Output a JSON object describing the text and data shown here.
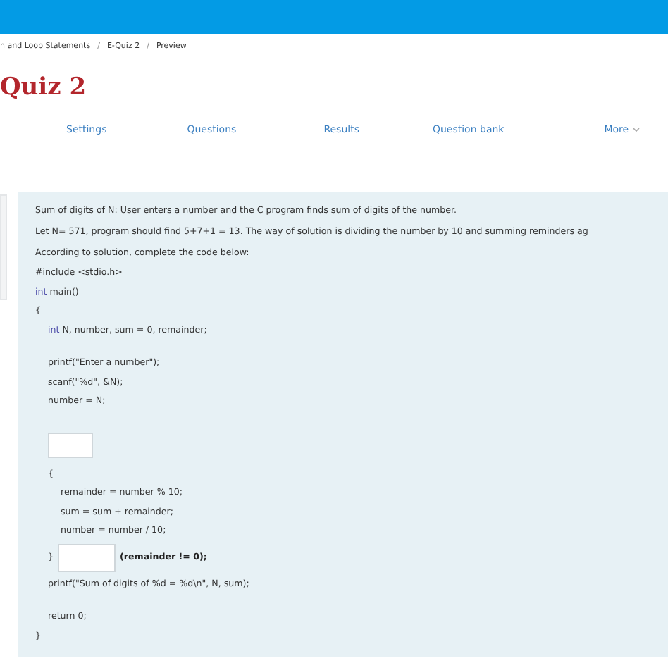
{
  "breadcrumb": {
    "separator": "/",
    "items": [
      "n and Loop Statements",
      "E-Quiz 2",
      "Preview"
    ]
  },
  "title": "Quiz 2",
  "tabs": [
    {
      "label": "Settings"
    },
    {
      "label": "Questions"
    },
    {
      "label": "Results"
    },
    {
      "label": "Question bank"
    },
    {
      "label": "More",
      "menu": true
    }
  ],
  "question": {
    "intro": [
      "Sum of digits of N: User enters a number and the C program finds sum of digits of the number.",
      "Let N= 571, program should find 5+7+1 = 13. The way of solution is dividing the number by 10 and summing reminders ag",
      "According to solution, complete the code below:"
    ],
    "code": [
      {
        "kind": "line",
        "text": "#include <stdio.h>"
      },
      {
        "kind": "line",
        "keyword": "int",
        "text": " main()"
      },
      {
        "kind": "line",
        "text": "{"
      },
      {
        "kind": "block",
        "children": [
          {
            "kind": "line",
            "keyword": "int",
            "text": " N, number, sum = 0, remainder;"
          },
          {
            "kind": "gap"
          },
          {
            "kind": "line",
            "text": "printf(\"Enter a number\");"
          },
          {
            "kind": "line",
            "text": "scanf(\"%d\", &N);"
          },
          {
            "kind": "line",
            "text": "number = N;"
          },
          {
            "kind": "gap"
          },
          {
            "kind": "blank"
          },
          {
            "kind": "line",
            "text": "{"
          },
          {
            "kind": "block",
            "children": [
              {
                "kind": "line",
                "text": "remainder = number % 10;"
              },
              {
                "kind": "line",
                "text": "sum = sum + remainder;"
              },
              {
                "kind": "line",
                "text": "number = number / 10;"
              }
            ]
          },
          {
            "kind": "blank_line",
            "before": "}",
            "after": "(remainder != 0);"
          },
          {
            "kind": "line",
            "text": "printf(\"Sum of digits of %d = %d\\n\", N, sum);"
          },
          {
            "kind": "gap"
          },
          {
            "kind": "line",
            "text": "return 0;"
          }
        ]
      },
      {
        "kind": "line",
        "text": "}"
      }
    ]
  }
}
